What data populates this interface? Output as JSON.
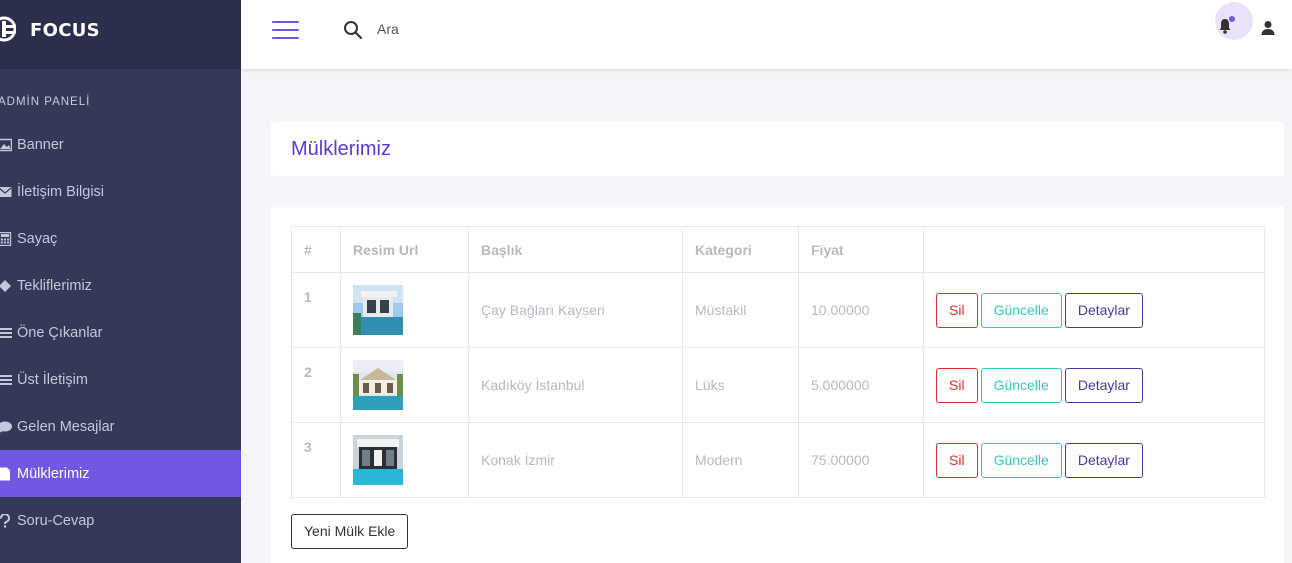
{
  "brand": {
    "name": "FOCUS"
  },
  "sidebar": {
    "section_title": "ADMİN PANELİ",
    "items": [
      {
        "label": "Banner",
        "icon": "image-icon"
      },
      {
        "label": "İletişim Bilgisi",
        "icon": "envelope-icon"
      },
      {
        "label": "Sayaç",
        "icon": "calculator-icon"
      },
      {
        "label": "Tekliflerimiz",
        "icon": "diamond-icon"
      },
      {
        "label": "Öne Çıkanlar",
        "icon": "list-icon"
      },
      {
        "label": "Üst İletişim",
        "icon": "list-icon"
      },
      {
        "label": "Gelen Mesajlar",
        "icon": "comment-icon"
      },
      {
        "label": "Mülklerimiz",
        "icon": "file-icon",
        "active": true
      },
      {
        "label": "Soru-Cevap",
        "icon": "question-icon"
      }
    ]
  },
  "header": {
    "search_placeholder": "Ara"
  },
  "page": {
    "title": "Mülklerimiz"
  },
  "table": {
    "headers": [
      "#",
      "Resim Url",
      "Başlık",
      "Kategori",
      "Fiyat",
      ""
    ],
    "rows": [
      {
        "num": "1",
        "title": "Çay Bağları Kayseri",
        "category": "Müstakil",
        "price": "10.00000"
      },
      {
        "num": "2",
        "title": "Kadıköy İstanbul",
        "category": "Lüks",
        "price": "5.000000"
      },
      {
        "num": "3",
        "title": "Konak İzmir",
        "category": "Modern",
        "price": "75.00000"
      }
    ],
    "actions": {
      "delete": "Sil",
      "update": "Güncelle",
      "details": "Detaylar"
    }
  },
  "add_button": "Yeni Mülk Ekle",
  "colors": {
    "sidebar": "#343957",
    "accent": "#7356e1",
    "title": "#593bdb"
  }
}
